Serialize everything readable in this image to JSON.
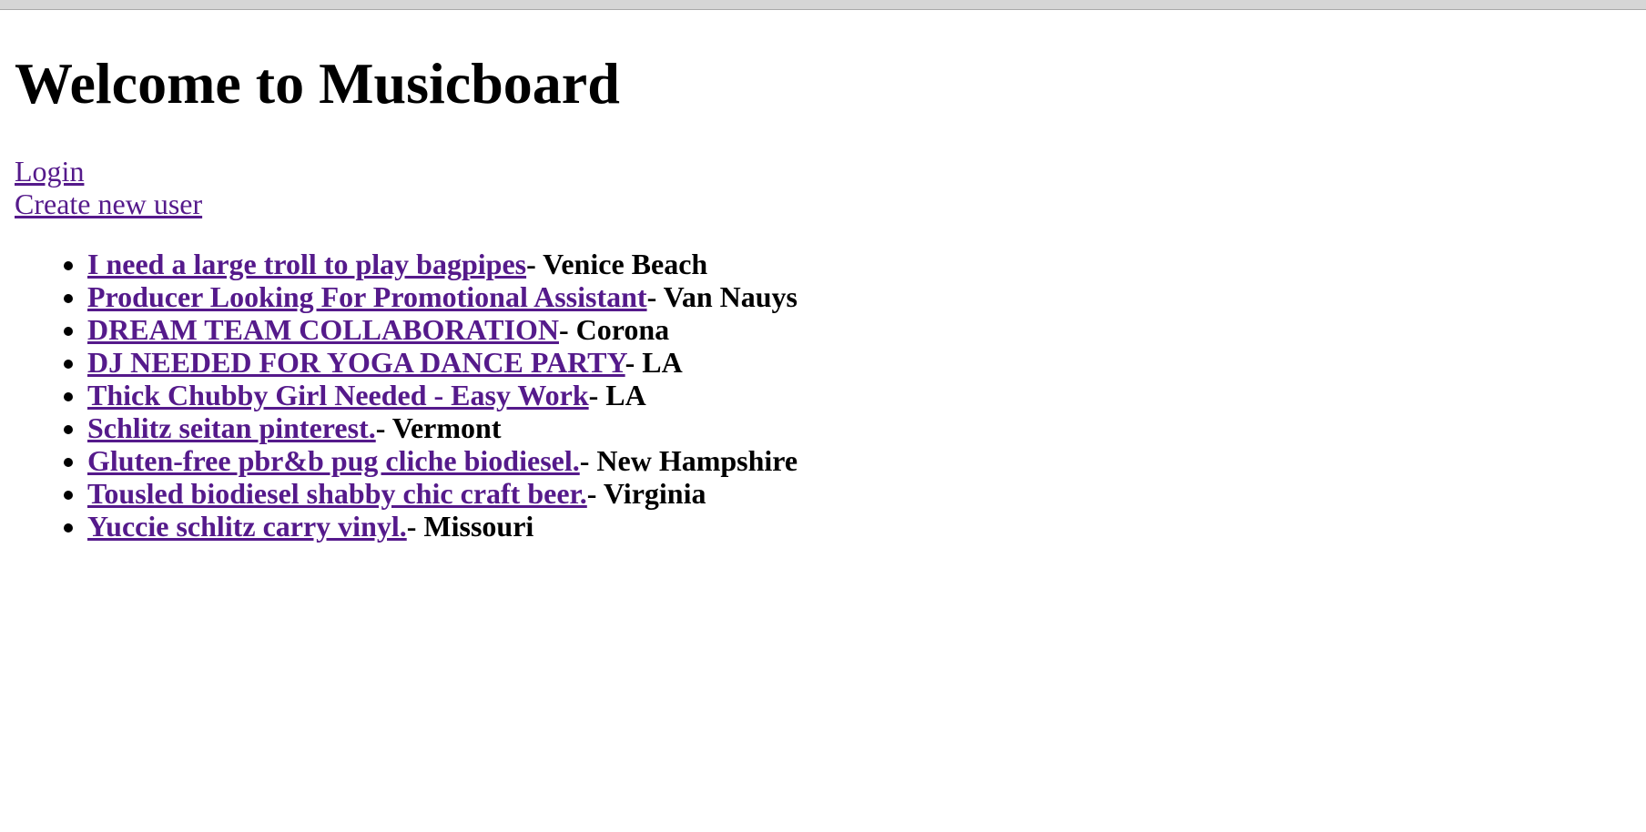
{
  "page": {
    "title": "Welcome to Musicboard"
  },
  "auth": {
    "login_label": "Login",
    "create_user_label": "Create new user"
  },
  "posts": [
    {
      "title": "I need a large troll to play bagpipes",
      "location": "- Venice Beach"
    },
    {
      "title": "Producer Looking For Promotional Assistant",
      "location": "- Van Nauys"
    },
    {
      "title": "DREAM TEAM COLLABORATION",
      "location": "- Corona"
    },
    {
      "title": "DJ NEEDED FOR YOGA DANCE PARTY",
      "location": "- LA"
    },
    {
      "title": "Thick Chubby Girl Needed - Easy Work",
      "location": "- LA"
    },
    {
      "title": "Schlitz seitan pinterest.",
      "location": "- Vermont"
    },
    {
      "title": "Gluten-free pbr&b pug cliche biodiesel.",
      "location": "- New Hampshire"
    },
    {
      "title": "Tousled biodiesel shabby chic craft beer.",
      "location": "- Virginia"
    },
    {
      "title": "Yuccie schlitz carry vinyl.",
      "location": "- Missouri"
    }
  ],
  "colors": {
    "link": "#551a8b",
    "text": "#000000",
    "top_bar": "#d6d6d6"
  }
}
